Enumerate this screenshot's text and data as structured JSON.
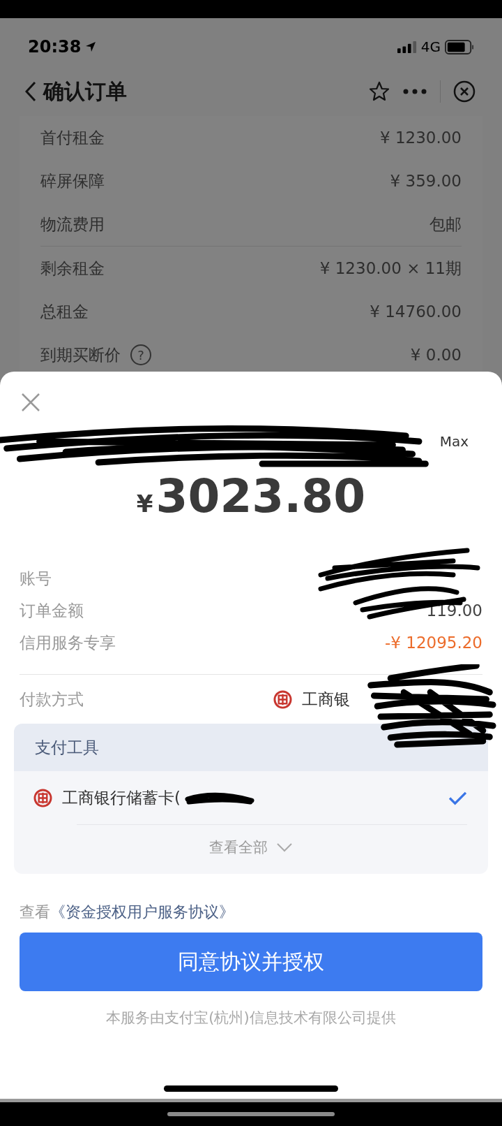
{
  "status_bar": {
    "time": "20:38",
    "network": "4G"
  },
  "nav": {
    "title": "确认订单"
  },
  "order_rows": [
    {
      "label": "首付租金",
      "value": "¥ 1230.00",
      "help": false,
      "divider_before": false
    },
    {
      "label": "碎屏保障",
      "value": "¥ 359.00",
      "help": false,
      "divider_before": false
    },
    {
      "label": "物流费用",
      "value": "包邮",
      "help": false,
      "divider_before": false
    },
    {
      "label": "剩余租金",
      "value": "¥ 1230.00 × 11期",
      "help": false,
      "divider_before": true
    },
    {
      "label": "总租金",
      "value": "¥ 14760.00",
      "help": false,
      "divider_before": false
    },
    {
      "label": "到期买断价",
      "value": "¥ 0.00",
      "help": true,
      "help_mark": "?",
      "divider_before": false
    }
  ],
  "sheet": {
    "title_visible": "Max",
    "currency": "¥",
    "amount": "3023.80",
    "details": [
      {
        "label": "账号",
        "kind": "plain"
      },
      {
        "label": "订单金额",
        "value": "119.00",
        "kind": "plain"
      },
      {
        "label": "信用服务专享",
        "value": "-¥ 12095.20",
        "kind": "discount"
      }
    ],
    "payment_method": {
      "label": "付款方式",
      "value": "工商银"
    },
    "tools": {
      "header": "支付工具",
      "items": [
        {
          "name": "工商银行储蓄卡(",
          "selected": true
        }
      ],
      "view_all": "查看全部"
    },
    "agreement": {
      "prefix": "查看",
      "link": "《资金授权用户服务协议》"
    },
    "button": "同意协议并授权",
    "footer": "本服务由支付宝(杭州)信息技术有限公司提供"
  }
}
